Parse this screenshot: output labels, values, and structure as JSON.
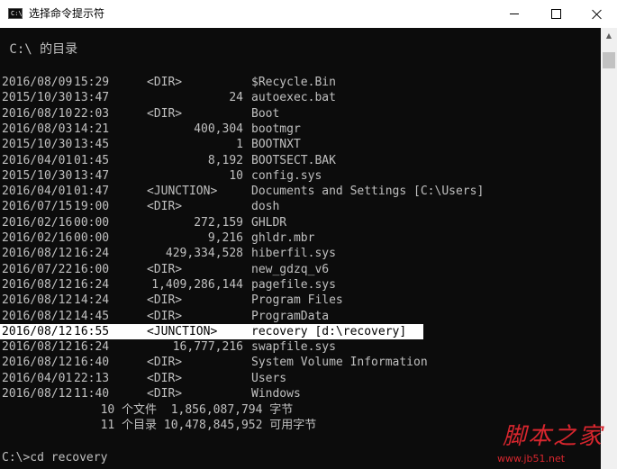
{
  "window": {
    "title": "选择命令提示符",
    "icon_text": "C:\\"
  },
  "console": {
    "heading": " C:\\ 的目录",
    "entries": [
      {
        "date": "2016/08/09",
        "time": "15:29",
        "type": "<DIR>",
        "size": "",
        "name": "$Recycle.Bin"
      },
      {
        "date": "2015/10/30",
        "time": "13:47",
        "type": "",
        "size": "24",
        "name": "autoexec.bat"
      },
      {
        "date": "2016/08/10",
        "time": "22:03",
        "type": "<DIR>",
        "size": "",
        "name": "Boot"
      },
      {
        "date": "2016/08/03",
        "time": "14:21",
        "type": "",
        "size": "400,304",
        "name": "bootmgr"
      },
      {
        "date": "2015/10/30",
        "time": "13:45",
        "type": "",
        "size": "1",
        "name": "BOOTNXT"
      },
      {
        "date": "2016/04/01",
        "time": "01:45",
        "type": "",
        "size": "8,192",
        "name": "BOOTSECT.BAK"
      },
      {
        "date": "2015/10/30",
        "time": "13:47",
        "type": "",
        "size": "10",
        "name": "config.sys"
      },
      {
        "date": "2016/04/01",
        "time": "01:47",
        "type": "<JUNCTION>",
        "size": "",
        "name": "Documents and Settings [C:\\Users]"
      },
      {
        "date": "2016/07/15",
        "time": "19:00",
        "type": "<DIR>",
        "size": "",
        "name": "dosh"
      },
      {
        "date": "2016/02/16",
        "time": "00:00",
        "type": "",
        "size": "272,159",
        "name": "GHLDR"
      },
      {
        "date": "2016/02/16",
        "time": "00:00",
        "type": "",
        "size": "9,216",
        "name": "ghldr.mbr"
      },
      {
        "date": "2016/08/12",
        "time": "16:24",
        "type": "",
        "size": "429,334,528",
        "name": "hiberfil.sys"
      },
      {
        "date": "2016/07/22",
        "time": "16:00",
        "type": "<DIR>",
        "size": "",
        "name": "new_gdzq_v6"
      },
      {
        "date": "2016/08/12",
        "time": "16:24",
        "type": "",
        "size": "1,409,286,144",
        "name": "pagefile.sys"
      },
      {
        "date": "2016/08/12",
        "time": "14:24",
        "type": "<DIR>",
        "size": "",
        "name": "Program Files"
      },
      {
        "date": "2016/08/12",
        "time": "14:45",
        "type": "<DIR>",
        "size": "",
        "name": "ProgramData"
      },
      {
        "date": "2016/08/12",
        "time": "16:55",
        "type": "<JUNCTION>",
        "size": "",
        "name": "recovery [d:\\recovery]"
      },
      {
        "date": "2016/08/12",
        "time": "16:24",
        "type": "",
        "size": "16,777,216",
        "name": "swapfile.sys"
      },
      {
        "date": "2016/08/12",
        "time": "16:40",
        "type": "<DIR>",
        "size": "",
        "name": "System Volume Information"
      },
      {
        "date": "2016/04/01",
        "time": "22:13",
        "type": "<DIR>",
        "size": "",
        "name": "Users"
      },
      {
        "date": "2016/08/12",
        "time": "11:40",
        "type": "<DIR>",
        "size": "",
        "name": "Windows"
      }
    ],
    "selected_name": "recovery [d:\\recovery]",
    "summary_files": "              10 个文件  1,856,087,794 字节",
    "summary_dirs": "              11 个目录 10,478,845,952 可用字节",
    "prompt": "C:\\>cd recovery"
  },
  "watermark": {
    "main": "脚本之家",
    "sub": "www.jb51.net"
  },
  "colors": {
    "console_bg": "#0c0c0c",
    "console_fg": "#c0c0c0",
    "selection_bg": "#ffffff",
    "watermark": "#d8262e"
  }
}
